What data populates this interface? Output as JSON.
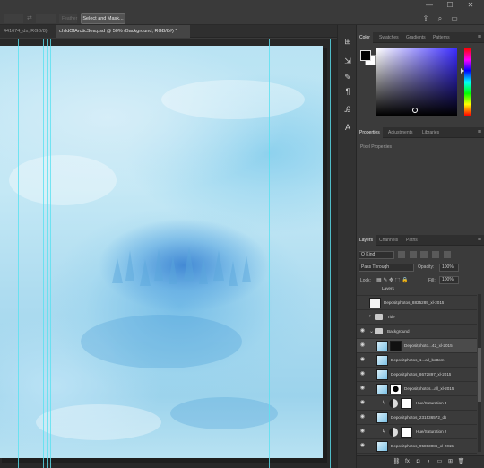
{
  "options_bar": {
    "field1": "",
    "field2": "",
    "field3": "Feather",
    "select_mask_label": "Select and Mask..."
  },
  "window": {
    "minimize": "—",
    "maximize": "☐",
    "close": "✕"
  },
  "tabs": [
    {
      "label": "441674_ds, RGB/8)"
    },
    {
      "label": "childOfArcticSea.psd @ 50% (Background, RGB/8#) *"
    }
  ],
  "tool_icons": [
    "align-icon",
    "adjust-icon",
    "brush-settings-icon",
    "paragraph-icon",
    "character-icon",
    "type-icon"
  ],
  "color_panel": {
    "tabs": [
      "Color",
      "Swatches",
      "Gradients",
      "Patterns"
    ],
    "foreground": "#000000",
    "background": "#ffffff"
  },
  "properties_panel": {
    "tabs": [
      "Properties",
      "Adjustments",
      "Libraries"
    ],
    "label": "Pixel Properties"
  },
  "layers_panel": {
    "tabs": [
      "Layers",
      "Channels",
      "Paths"
    ],
    "filter_kind": "Q Kind",
    "blend_mode": "Pass Through",
    "opacity_label": "Opacity:",
    "opacity_value": "100%",
    "lock_label": "Lock:",
    "fill_label": "Fill:",
    "fill_value": "100%",
    "layers": [
      {
        "name": "Layers",
        "type": "group-header"
      },
      {
        "name": "Depositphotos_8835289_xl-2015",
        "type": "pixel"
      },
      {
        "name": "Title",
        "type": "group"
      },
      {
        "name": "Background",
        "type": "group-open"
      },
      {
        "name": "Depositphoto...42_xl-2015",
        "type": "masked"
      },
      {
        "name": "Depositphotos_1...all_bottom",
        "type": "pixel"
      },
      {
        "name": "Depositphotos_8672897_xl-2015",
        "type": "pixel"
      },
      {
        "name": "Depositphotos...all_xl-2015",
        "type": "masked"
      },
      {
        "name": "Hue/Saturation 3",
        "type": "adjustment"
      },
      {
        "name": "Depositphotos_231536572_ds",
        "type": "pixel"
      },
      {
        "name": "Hue/Saturation 2",
        "type": "adjustment"
      },
      {
        "name": "Depositphotos_95803086_xl-2015",
        "type": "pixel"
      }
    ],
    "footer_icons": [
      "link-icon",
      "fx-icon",
      "mask-icon",
      "adjustment-icon",
      "group-icon",
      "new-layer-icon",
      "trash-icon"
    ]
  }
}
